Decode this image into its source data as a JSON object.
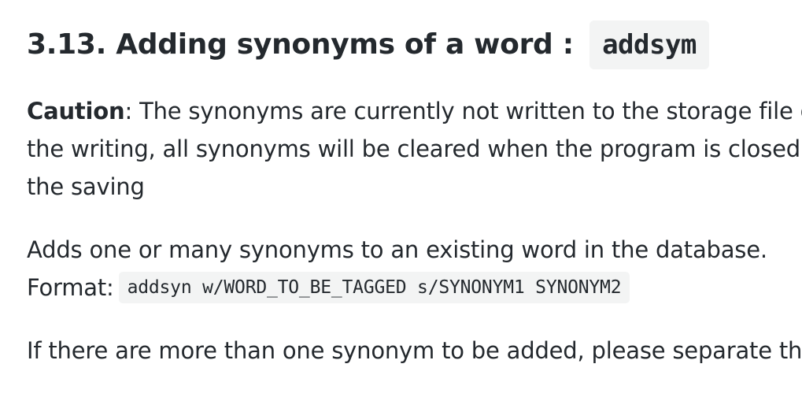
{
  "heading": {
    "text": "3.13. Adding synonyms of a word :",
    "code": "addsym"
  },
  "caution": {
    "label": "Caution",
    "line1": ": The synonyms are currently not written to the storage file du",
    "line2": "the writing, all synonyms will be cleared when the program is closed. V",
    "line3": "the saving"
  },
  "description": {
    "line1": "Adds one or many synonyms to an existing word in the database.",
    "format_label": "Format:",
    "format_code": "addsyn w/WORD_TO_BE_TAGGED s/SYNONYM1 SYNONYM2"
  },
  "note": {
    "text": "If there are more than one synonym to be added, please separate ther"
  }
}
